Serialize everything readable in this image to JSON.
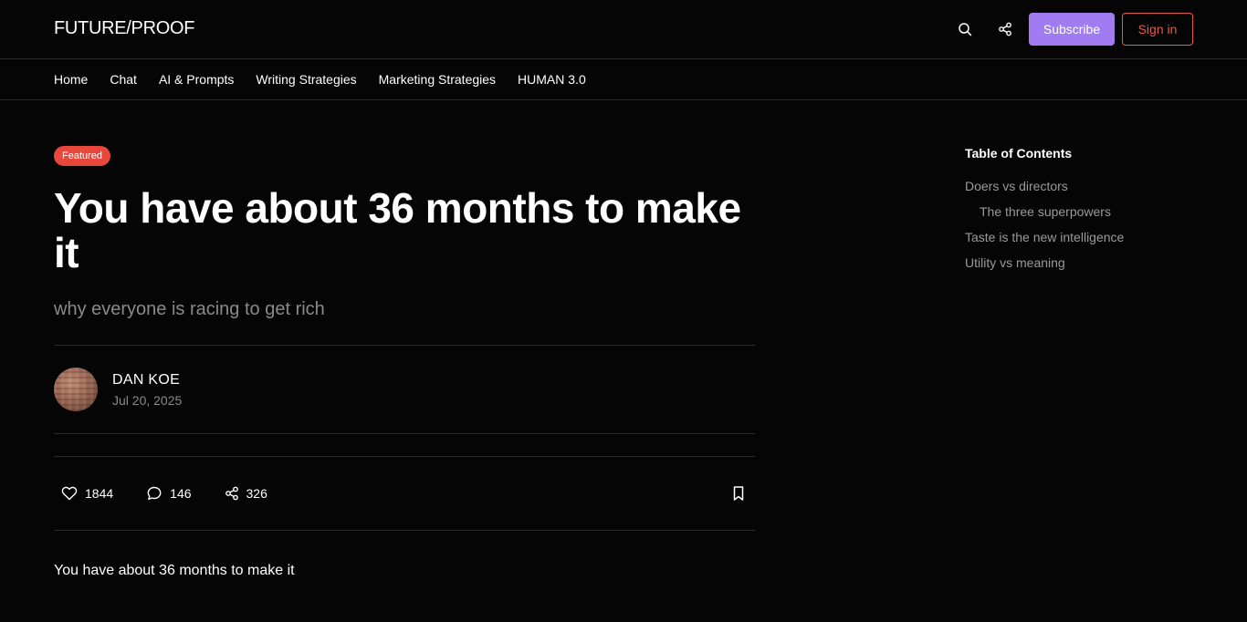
{
  "header": {
    "logo": "FUTURE/PROOF",
    "subscribe_label": "Subscribe",
    "signin_label": "Sign in",
    "icons": [
      "search-icon",
      "share-icon"
    ]
  },
  "nav": {
    "items": [
      "Home",
      "Chat",
      "AI & Prompts",
      "Writing Strategies",
      "Marketing Strategies",
      "HUMAN 3.0"
    ]
  },
  "article": {
    "badge": "Featured",
    "title": "You have about 36 months to make it",
    "subtitle": "why everyone is racing to get rich",
    "author": "DAN KOE",
    "date": "Jul 20, 2025",
    "likes": "1844",
    "comments": "146",
    "shares": "326",
    "body_first_line": "You have about 36 months to make it"
  },
  "toc": {
    "title": "Table of Contents",
    "items": [
      "Doers vs directors",
      "The three superpowers",
      "Taste is the new intelligence",
      "Utility vs meaning"
    ]
  },
  "colors": {
    "background": "#050505",
    "accent_subscribe": "#a07cf0",
    "accent_signin": "#e55a4a",
    "badge": "#e8483b",
    "muted_text": "#8a8a8a"
  }
}
